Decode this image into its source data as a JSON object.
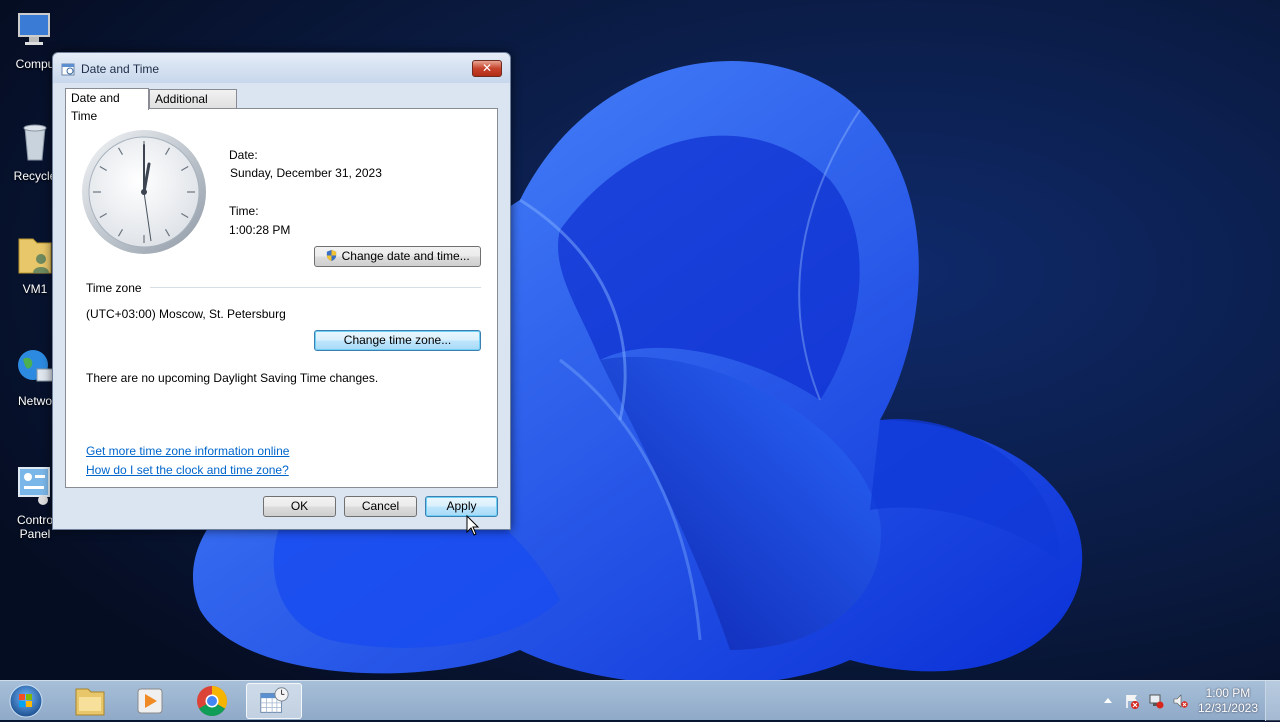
{
  "desktop": {
    "icons": [
      {
        "label": "Compu"
      },
      {
        "label": "Recycle"
      },
      {
        "label": "VM1"
      },
      {
        "label": "Netwo"
      },
      {
        "label": "Contro\nPanel"
      }
    ]
  },
  "dialog": {
    "title": "Date and Time",
    "close_label": "✕",
    "tabs": [
      {
        "label": "Date and Time",
        "active": true
      },
      {
        "label": "Additional Clocks",
        "active": false
      }
    ],
    "date_label": "Date:",
    "date_value": "Sunday, December 31, 2023",
    "time_label": "Time:",
    "time_value": "1:00:28 PM",
    "change_datetime_button": "Change date and time...",
    "timezone_heading": "Time zone",
    "timezone_value": "(UTC+03:00) Moscow, St. Petersburg",
    "change_timezone_button": "Change time zone...",
    "dst_message": "There are no upcoming Daylight Saving Time changes.",
    "link_more_info": "Get more time zone information online",
    "link_how_to": "How do I set the clock and time zone?",
    "ok_button": "OK",
    "cancel_button": "Cancel",
    "apply_button": "Apply"
  },
  "taskbar": {
    "pinned": [
      {
        "icon": "file-explorer-icon"
      },
      {
        "icon": "media-player-icon"
      },
      {
        "icon": "chrome-icon"
      },
      {
        "icon": "date-time-icon",
        "active": true
      }
    ],
    "tray_time": "1:00 PM",
    "tray_date": "12/31/2023"
  },
  "colors": {
    "link": "#0066cc",
    "wallpaper_dark": "#07152e",
    "wallpaper_bloom": "#1f5cff"
  }
}
